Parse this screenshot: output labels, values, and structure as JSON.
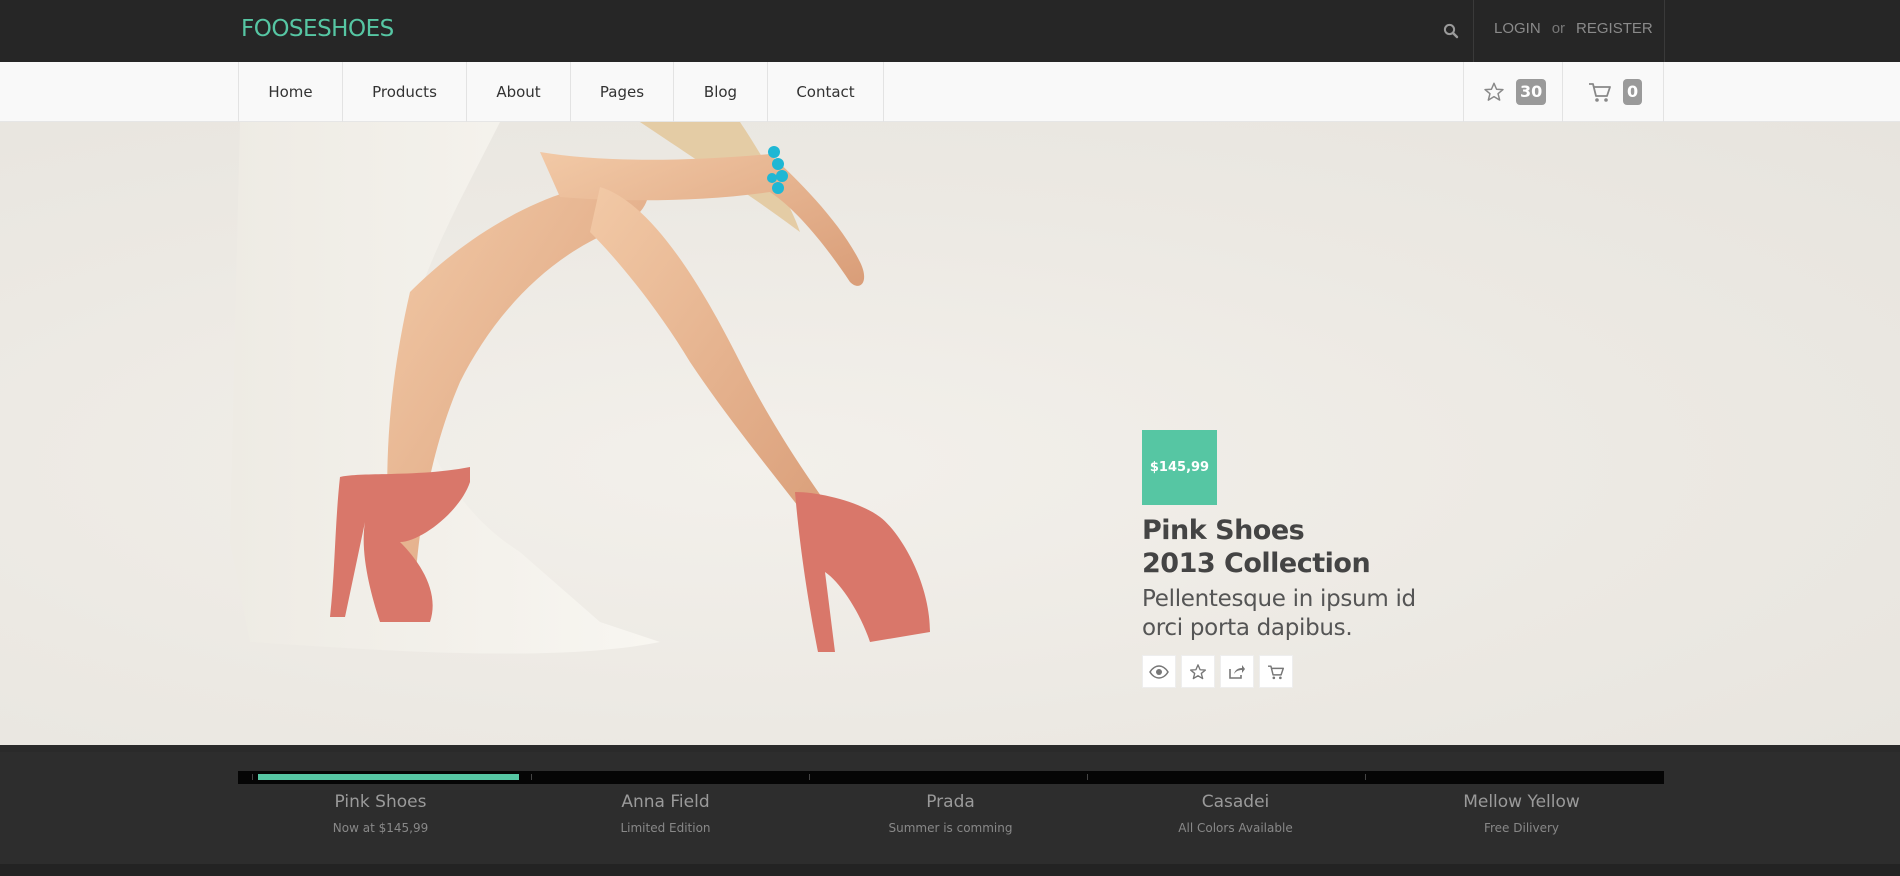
{
  "brand": {
    "logo": "FOOSESHOES",
    "accent": "#56c6a3"
  },
  "topbar": {
    "search_icon": "search-icon",
    "login": "LOGIN",
    "or": "or",
    "register": "REGISTER"
  },
  "nav": {
    "items": [
      {
        "label": "Home"
      },
      {
        "label": "Products"
      },
      {
        "label": "About"
      },
      {
        "label": "Pages"
      },
      {
        "label": "Blog"
      },
      {
        "label": "Contact"
      }
    ],
    "wishlist": {
      "icon": "star-icon",
      "count": "30"
    },
    "cart": {
      "icon": "cart-icon",
      "count": "0"
    }
  },
  "hero": {
    "price": "$145,99",
    "title_line1": "Pink Shoes",
    "title_line2": "2013 Collection",
    "subtitle": "Pellentesque in ipsum id orci porta dapibus.",
    "actions": [
      "eye-icon",
      "star-icon",
      "share-icon",
      "cart-add-icon"
    ]
  },
  "slider": {
    "progress": 0.19,
    "items": [
      {
        "title": "Pink Shoes",
        "caption": "Now at $145,99"
      },
      {
        "title": "Anna Field",
        "caption": "Limited Edition"
      },
      {
        "title": "Prada",
        "caption": "Summer is comming"
      },
      {
        "title": "Casadei",
        "caption": "All Colors Available"
      },
      {
        "title": "Mellow Yellow",
        "caption": "Free Dilivery"
      }
    ]
  }
}
